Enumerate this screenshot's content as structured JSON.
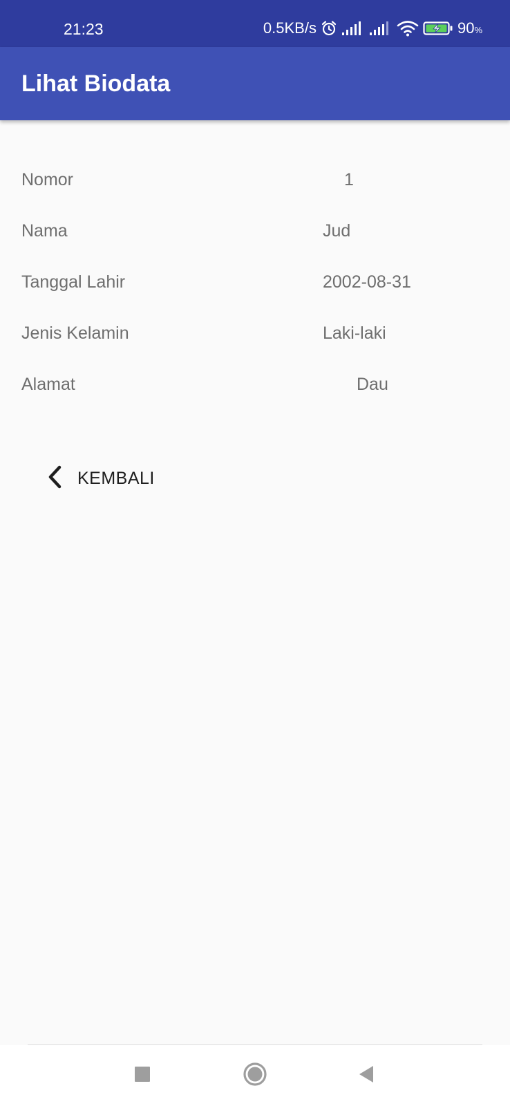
{
  "status_bar": {
    "time": "21:23",
    "network_speed": "0.5KB/s",
    "battery_level": "90",
    "battery_unit": "%",
    "icons": [
      "alarm-icon",
      "signal-icon",
      "signal-icon",
      "wifi-icon",
      "battery-charging-icon"
    ]
  },
  "app_bar": {
    "title": "Lihat Biodata",
    "color": "#3f51b5"
  },
  "biodata": [
    {
      "label": "Nomor",
      "value": "1"
    },
    {
      "label": "Nama",
      "value": "Jud"
    },
    {
      "label": "Tanggal Lahir",
      "value": "2002-08-31"
    },
    {
      "label": "Jenis Kelamin",
      "value": "Laki-laki"
    },
    {
      "label": "Alamat",
      "value": "Dau"
    }
  ],
  "back_button": {
    "label": "KEMBALI",
    "icon": "chevron-left-icon"
  },
  "nav_bar": {
    "buttons": [
      "recents-icon",
      "home-icon",
      "back-icon"
    ]
  }
}
